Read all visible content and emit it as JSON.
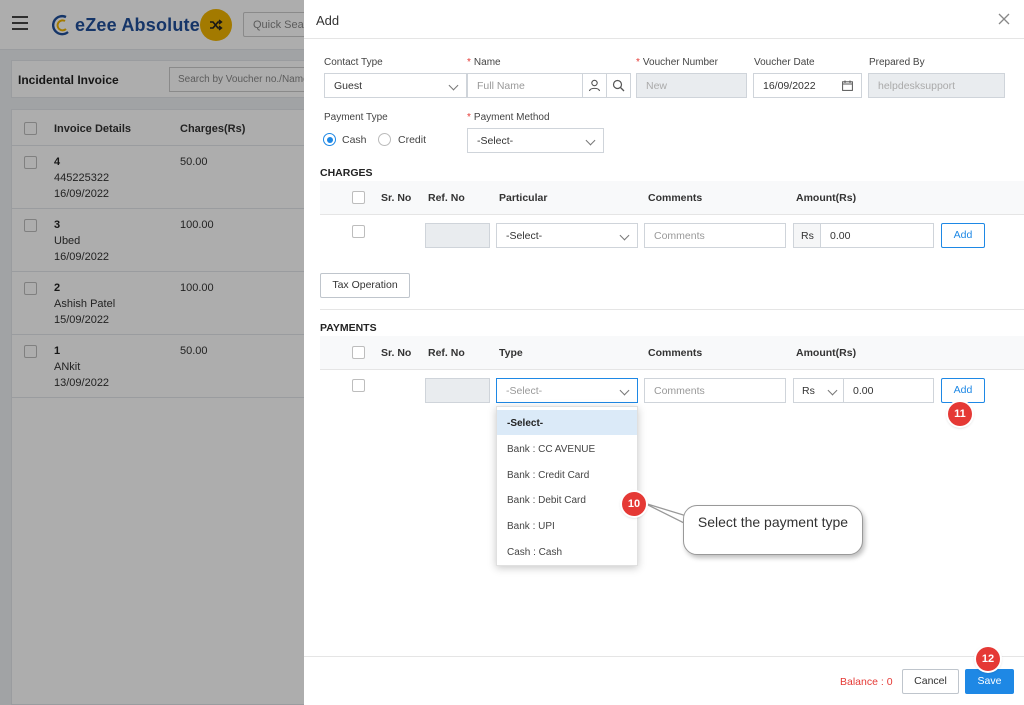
{
  "app": {
    "brand": "eZee Absolute",
    "quick_search_placeholder": "Quick Search",
    "page_title": "Incidental Invoice",
    "list_search_placeholder": "Search by Voucher no./Name",
    "list_headers": {
      "details": "Invoice Details",
      "charges": "Charges(Rs)"
    },
    "invoices": [
      {
        "number": "4",
        "name": "445225322",
        "date": "16/09/2022",
        "charges": "50.00"
      },
      {
        "number": "3",
        "name": "Ubed",
        "date": "16/09/2022",
        "charges": "100.00"
      },
      {
        "number": "2",
        "name": "Ashish Patel",
        "date": "15/09/2022",
        "charges": "100.00"
      },
      {
        "number": "1",
        "name": "ANkit",
        "date": "13/09/2022",
        "charges": "50.00"
      }
    ]
  },
  "modal": {
    "title": "Add",
    "form": {
      "contact_type_label": "Contact Type",
      "contact_type_value": "Guest",
      "name_label": "Name",
      "name_placeholder": "Full Name",
      "voucher_number_label": "Voucher Number",
      "voucher_number_value": "New",
      "voucher_date_label": "Voucher Date",
      "voucher_date_value": "16/09/2022",
      "prepared_by_label": "Prepared By",
      "prepared_by_value": "helpdesksupport",
      "payment_type_label": "Payment Type",
      "payment_type_options": [
        "Cash",
        "Credit"
      ],
      "payment_type_selected": "Cash",
      "payment_method_label": "Payment Method",
      "payment_method_value": "-Select-"
    },
    "charges": {
      "title": "CHARGES",
      "headers": {
        "sr_no": "Sr. No",
        "ref_no": "Ref. No",
        "particular": "Particular",
        "comments": "Comments",
        "amount": "Amount(Rs)"
      },
      "particular_value": "-Select-",
      "comments_placeholder": "Comments",
      "currency": "Rs",
      "amount": "0.00",
      "add_label": "Add",
      "tax_operation_label": "Tax Operation"
    },
    "payments": {
      "title": "PAYMENTS",
      "headers": {
        "sr_no": "Sr. No",
        "ref_no": "Ref. No",
        "type": "Type",
        "comments": "Comments",
        "amount": "Amount(Rs)"
      },
      "type_value": "-Select-",
      "comments_placeholder": "Comments",
      "currency": "Rs",
      "amount": "0.00",
      "add_label": "Add",
      "type_options": [
        "-Select-",
        "Bank : CC AVENUE",
        "Bank : Credit Card",
        "Bank : Debit Card",
        "Bank : UPI",
        "Cash : Cash"
      ],
      "type_highlighted": "-Select-"
    },
    "footer": {
      "balance": "Balance : 0",
      "cancel_label": "Cancel",
      "save_label": "Save"
    }
  },
  "annotations": {
    "badge_10": "10",
    "badge_11": "11",
    "badge_12": "12",
    "callout_text": "Select the payment type"
  },
  "colors": {
    "accent": "#1e88e5",
    "brand": "#1f4e9a",
    "badge": "#e53935",
    "shuffle": "#f0b400"
  }
}
